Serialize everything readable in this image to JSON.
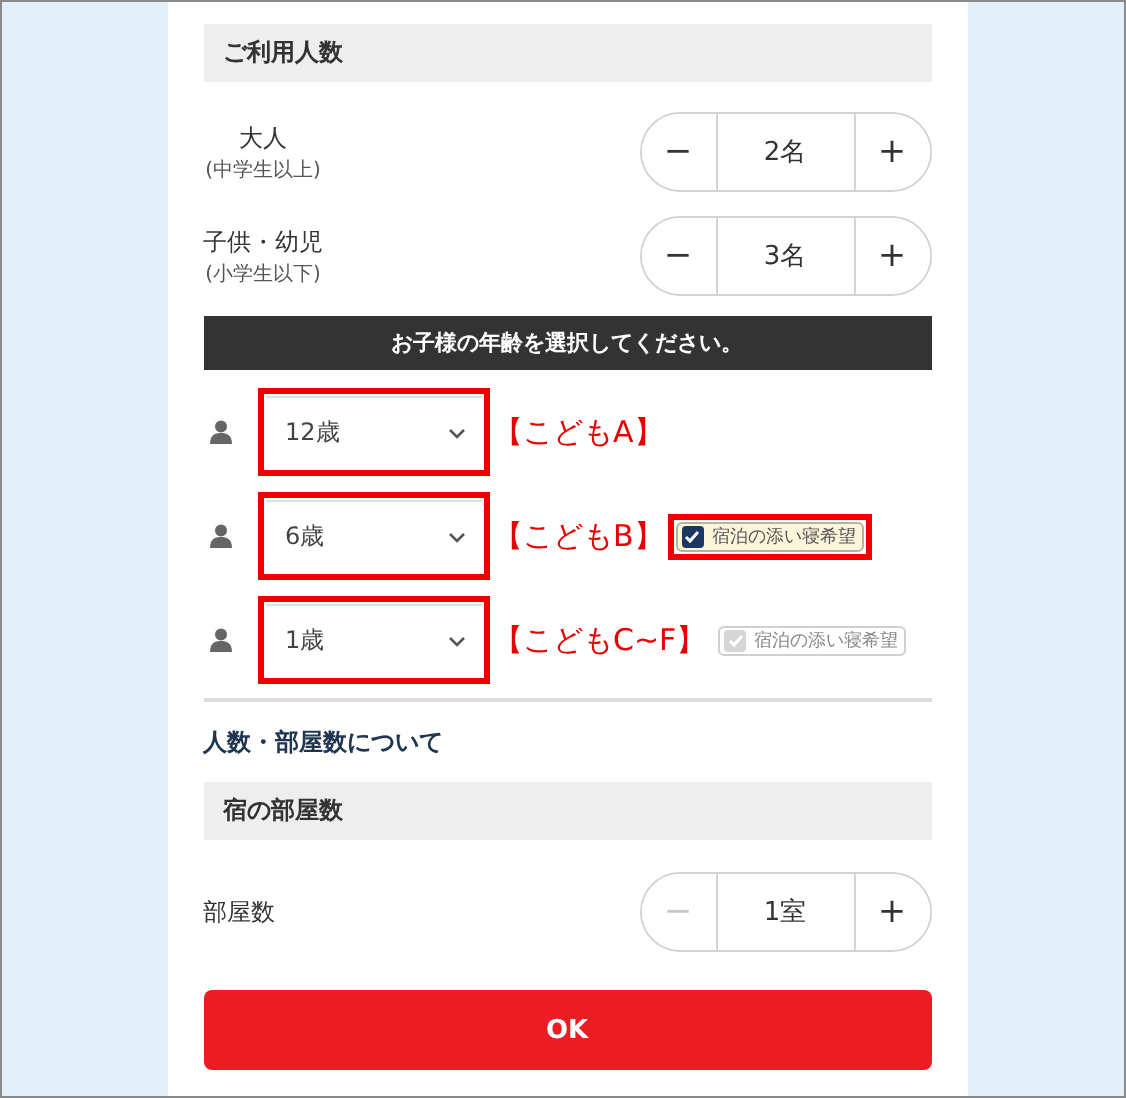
{
  "guest_section": {
    "title": "ご利用人数"
  },
  "counters": [
    {
      "label": "大人",
      "sublabel": "(中学生以上)",
      "value": "2名",
      "minus_disabled": false,
      "minus": "−",
      "plus": "+"
    },
    {
      "label": "子供・幼児",
      "sublabel": "(小学生以下)",
      "value": "3名",
      "minus_disabled": false,
      "minus": "−",
      "plus": "+"
    }
  ],
  "child_age_banner": "お子様の年齢を選択してください。",
  "children": [
    {
      "age": "12歳",
      "annotation": "【こどもA】",
      "highlighted": true
    },
    {
      "age": "6歳",
      "annotation": "【こどもB】",
      "highlighted": true,
      "co_sleeping": {
        "label": "宿泊の添い寝希望",
        "checked": true,
        "disabled": false,
        "highlighted": true
      }
    },
    {
      "age": "1歳",
      "annotation": "【こどもC~F】",
      "highlighted": true,
      "co_sleeping": {
        "label": "宿泊の添い寝希望",
        "checked": true,
        "disabled": true,
        "highlighted": false
      }
    }
  ],
  "about_link": "人数・部屋数について",
  "room_section": {
    "title": "宿の部屋数"
  },
  "room_counter": {
    "label": "部屋数",
    "value": "1室",
    "minus_disabled": true,
    "minus": "−",
    "plus": "+"
  },
  "ok_button": "OK"
}
